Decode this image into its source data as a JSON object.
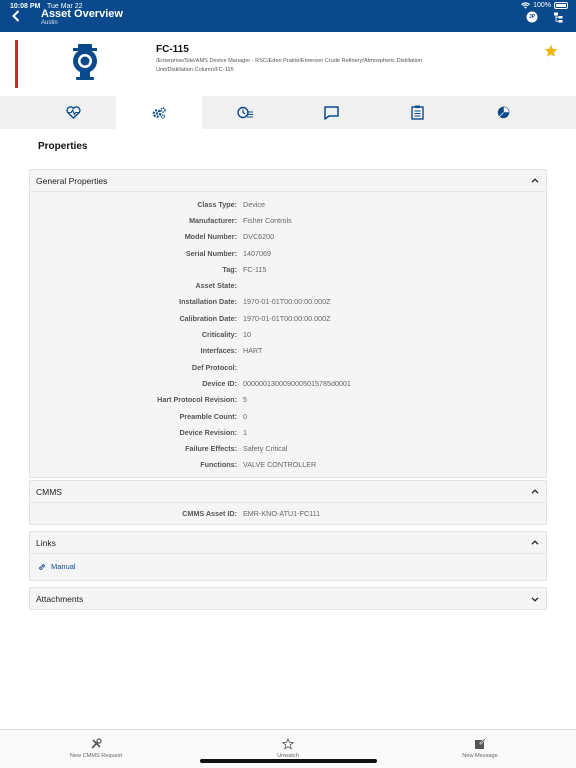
{
  "status_bar": {
    "time": "10:08 PM",
    "date": "Tue Mar 22",
    "battery": "100%"
  },
  "header": {
    "title": "Asset Overview",
    "subtitle": "Austin",
    "user_initials": "JP"
  },
  "asset": {
    "name": "FC-115",
    "path": "/Enterprise/Site/AMS Device Manager - RSC/Eden Prairie/Emerson Crude Refinery/Atmospheric Distillation Unit/Distillation Column/FC-115"
  },
  "page_title": "Properties",
  "general": {
    "title": "General Properties",
    "rows": [
      {
        "label": "Class Type:",
        "value": "Device"
      },
      {
        "label": "Manufacturer:",
        "value": "Fisher Controls"
      },
      {
        "label": "Model Number:",
        "value": "DVC6200"
      },
      {
        "label": "Serial Number:",
        "value": "1407069"
      },
      {
        "label": "Tag:",
        "value": "FC-115"
      },
      {
        "label": "Asset State:",
        "value": ""
      },
      {
        "label": "Installation Date:",
        "value": "1970-01-01T00:00:00.000Z"
      },
      {
        "label": "Calibration Date:",
        "value": "1970-01-01T00:00:00.000Z"
      },
      {
        "label": "Criticality:",
        "value": "10"
      },
      {
        "label": "Interfaces:",
        "value": "HART"
      },
      {
        "label": "Def Protocol:",
        "value": ""
      },
      {
        "label": "Device ID:",
        "value": "0000001300090005015785d0001"
      },
      {
        "label": "Hart Protocol Revision:",
        "value": "5"
      },
      {
        "label": "Preamble Count:",
        "value": "0"
      },
      {
        "label": "Device Revision:",
        "value": "1"
      },
      {
        "label": "Failure Effects:",
        "value": "Safety Critical"
      },
      {
        "label": "Functions:",
        "value": "VALVE CONTROLLER"
      }
    ]
  },
  "cmms": {
    "title": "CMMS",
    "label": "CMMS Asset ID:",
    "value": "EMR-KNO-ATU1-FC111"
  },
  "links": {
    "title": "Links",
    "manual": "Manual"
  },
  "attachments": {
    "title": "Attachments"
  },
  "bottom_bar": {
    "new_request": "New CMMS Request",
    "unwatch": "Unwatch",
    "new_message": "New Message"
  },
  "colors": {
    "brand": "#0a4a8c",
    "alert": "#d42027",
    "star": "#f5b400"
  }
}
